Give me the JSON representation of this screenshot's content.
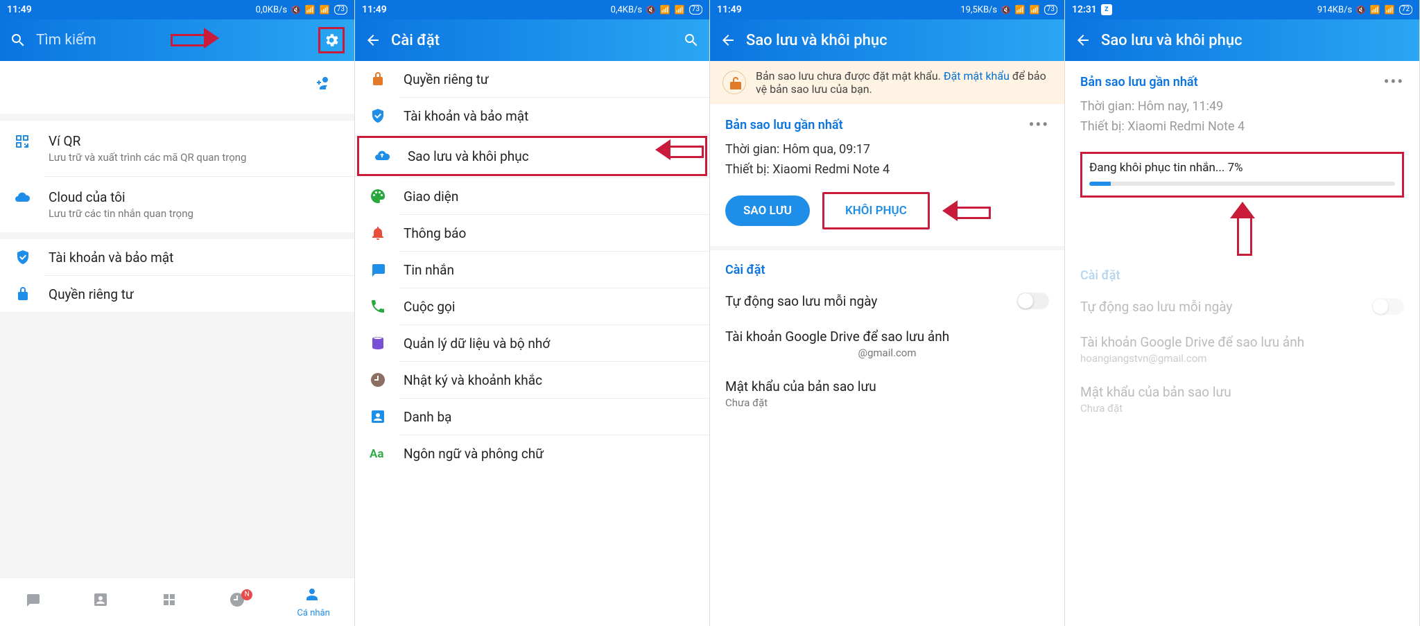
{
  "s1": {
    "status": {
      "time": "11:49",
      "net": "0,0KB/s",
      "batt": "73"
    },
    "search_placeholder": "Tìm kiếm",
    "items": {
      "qr_title": "Ví QR",
      "qr_sub": "Lưu trữ và xuất trình các mã QR quan trọng",
      "cloud_title": "Cloud của tôi",
      "cloud_sub": "Lưu trữ các tin nhắn quan trọng",
      "security": "Tài khoản và bảo mật",
      "privacy": "Quyền riêng tư"
    },
    "nav_dot": "N",
    "nav_sel_label": "Cá nhân"
  },
  "s2": {
    "status": {
      "time": "11:49",
      "net": "0,4KB/s",
      "batt": "73"
    },
    "title": "Cài đặt",
    "items": {
      "privacy": "Quyền riêng tư",
      "security": "Tài khoản và bảo mật",
      "backup": "Sao lưu và khôi phục",
      "theme": "Giao diện",
      "notify": "Thông báo",
      "message": "Tin nhắn",
      "call": "Cuộc gọi",
      "storage": "Quản lý dữ liệu và bộ nhớ",
      "diary": "Nhật ký và khoảnh khắc",
      "contacts": "Danh bạ",
      "lang": "Ngôn ngữ và phông chữ"
    }
  },
  "s3": {
    "status": {
      "time": "11:49",
      "net": "19,5KB/s",
      "batt": "73"
    },
    "title": "Sao lưu và khôi phục",
    "banner_pre": "Bản sao lưu chưa được đặt mật khẩu. ",
    "banner_link": "Đặt mật khẩu",
    "banner_post": " để bảo vệ bản sao lưu của bạn.",
    "latest_title": "Bản sao lưu gần nhất",
    "time_line": "Thời gian: Hôm qua, 09:17",
    "device_line": "Thiết bị: Xiaomi Redmi Note 4",
    "btn_backup": "SAO LƯU",
    "btn_restore": "KHÔI PHỤC",
    "settings_title": "Cài đặt",
    "auto": "Tự động sao lưu mỗi ngày",
    "gdrive_title": "Tài khoản Google Drive để sao lưu ảnh",
    "gdrive_sub": "@gmail.com",
    "pw_title": "Mật khẩu của bản sao lưu",
    "pw_sub": "Chưa đặt"
  },
  "s4": {
    "status": {
      "time": "12:31",
      "net": "914KB/s",
      "batt": "72"
    },
    "title": "Sao lưu và khôi phục",
    "latest_title": "Bản sao lưu gần nhất",
    "time_line": "Thời gian: Hôm nay, 11:49",
    "device_line": "Thiết bị: Xiaomi Redmi Note 4",
    "progress_label": "Đang khôi phục tin nhắn... 7%",
    "progress_pct": 7,
    "settings_title": "Cài đặt",
    "auto": "Tự động sao lưu mỗi ngày",
    "gdrive_title": "Tài khoản Google Drive để sao lưu ảnh",
    "gdrive_sub": "hoangiangstvn@gmail.com",
    "pw_title": "Mật khẩu của bản sao lưu",
    "pw_sub": "Chưa đặt"
  }
}
